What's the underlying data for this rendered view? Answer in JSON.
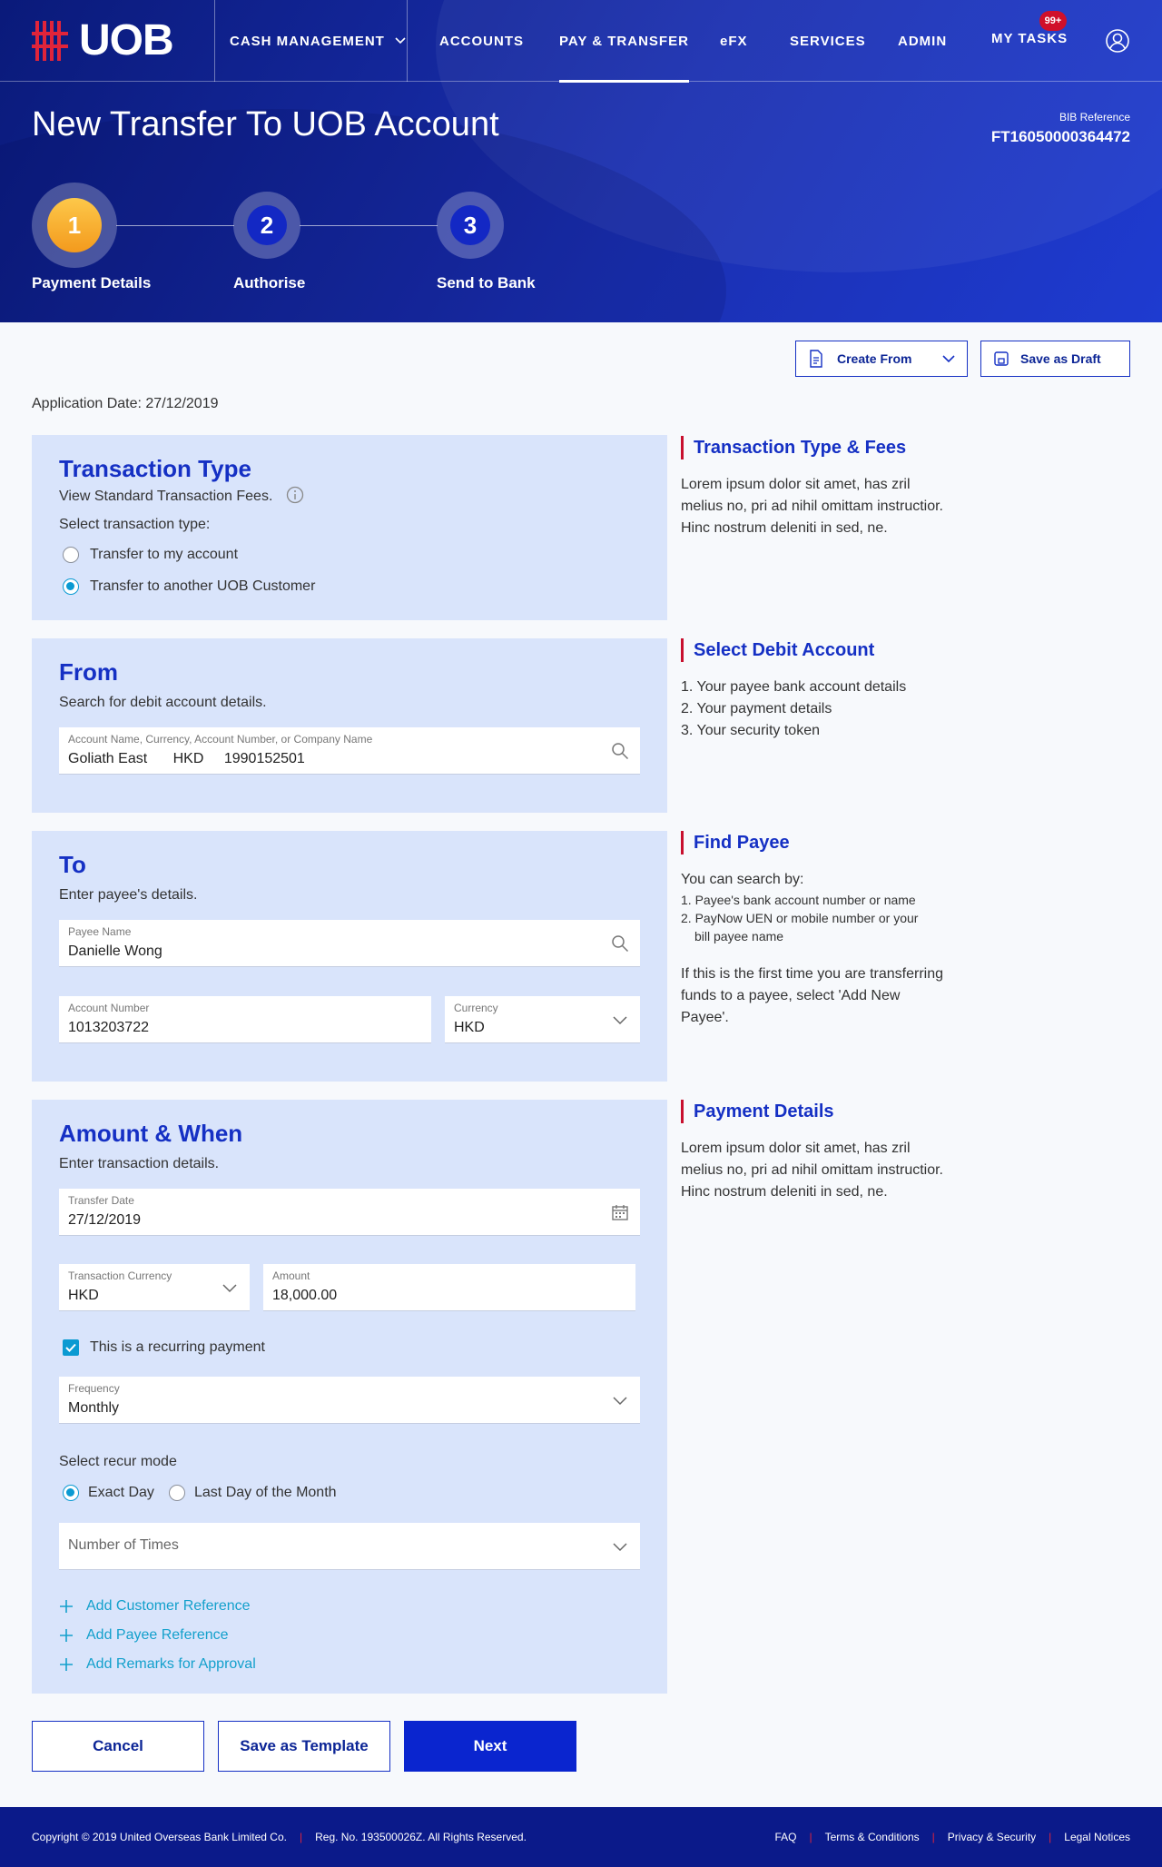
{
  "brand": {
    "name": "UOB"
  },
  "nav": {
    "items": [
      "CASH MANAGEMENT",
      "ACCOUNTS",
      "PAY & TRANSFER",
      "eFX",
      "SERVICES",
      "ADMIN",
      "MY TASKS"
    ],
    "active": "PAY & TRANSFER",
    "tasks_badge": "99+"
  },
  "page": {
    "title": "New Transfer To UOB Account",
    "bib_label": "BIB Reference",
    "bib_value": "FT16050000364472"
  },
  "steps": [
    {
      "number": "1",
      "label": "Payment Details"
    },
    {
      "number": "2",
      "label": "Authorise"
    },
    {
      "number": "3",
      "label": "Send to Bank"
    }
  ],
  "actions": {
    "create_from": "Create From",
    "save_draft": "Save as Draft"
  },
  "application_date": "Application Date: 27/12/2019",
  "transaction_type": {
    "title": "Transaction Type",
    "fees_text": "View Standard Transaction Fees.",
    "select_label": "Select transaction type:",
    "options": [
      "Transfer to my account",
      "Transfer to another UOB Customer"
    ],
    "selected_index": 1
  },
  "from": {
    "title": "From",
    "subtitle": "Search for debit account details.",
    "field_label": "Account Name, Currency, Account Number, or Company Name",
    "account_name": "Goliath East",
    "currency": "HKD",
    "account_number": "1990152501"
  },
  "to": {
    "title": "To",
    "subtitle": "Enter payee's details.",
    "payee_label": "Payee Name",
    "payee_value": "Danielle Wong",
    "account_label": "Account Number",
    "account_value": "1013203722",
    "currency_label": "Currency",
    "currency_value": "HKD"
  },
  "amount": {
    "title": "Amount & When",
    "subtitle": "Enter transaction details.",
    "date_label": "Transfer Date",
    "date_value": "27/12/2019",
    "txn_currency_label": "Transaction Currency",
    "txn_currency_value": "HKD",
    "amount_label": "Amount",
    "amount_value": "18,000.00",
    "recurring_label": "This is a recurring payment",
    "recurring_checked": true,
    "frequency_label": "Frequency",
    "frequency_value": "Monthly",
    "recur_mode_label": "Select recur mode",
    "recur_modes": [
      "Exact Day",
      "Last Day of the Month"
    ],
    "recur_selected_index": 0,
    "times_placeholder": "Number of Times",
    "links": [
      "Add Customer Reference",
      "Add Payee Reference",
      "Add Remarks for Approval"
    ]
  },
  "sidebar": {
    "type_fees": {
      "title": "Transaction Type & Fees",
      "text": "Lorem ipsum dolor sit amet, has zril melius no, pri ad nihil omittam instructior. Hinc nostrum deleniti in sed, ne."
    },
    "debit": {
      "title": "Select Debit Account",
      "items": [
        "1. Your payee bank account details",
        "2. Your payment details",
        "3. Your security token"
      ]
    },
    "payee": {
      "title": "Find Payee",
      "intro": "You can search by:",
      "items": [
        "1. Payee's bank account number or name",
        "2. PayNow UEN or mobile number or your",
        "bill payee name"
      ],
      "note": "If this is the first time you are transferring funds to a payee, select 'Add New Payee'."
    },
    "payment": {
      "title": "Payment Details",
      "text": "Lorem ipsum dolor sit amet, has zril melius no, pri ad nihil omittam instructior. Hinc nostrum deleniti in sed, ne."
    }
  },
  "buttons": {
    "cancel": "Cancel",
    "template": "Save as Template",
    "next": "Next"
  },
  "footer": {
    "copyright": "Copyright © 2019 United Overseas Bank Limited Co.",
    "reg": "Reg. No. 193500026Z. All Rights Reserved.",
    "links": [
      "FAQ",
      "Terms & Conditions",
      "Privacy & Security",
      "Legal Notices"
    ]
  },
  "colors": {
    "primary": "#1530c4",
    "accent": "#f7a823",
    "link": "#13a0cc",
    "footer": "#0b1a8a",
    "card": "#d9e4fb"
  }
}
